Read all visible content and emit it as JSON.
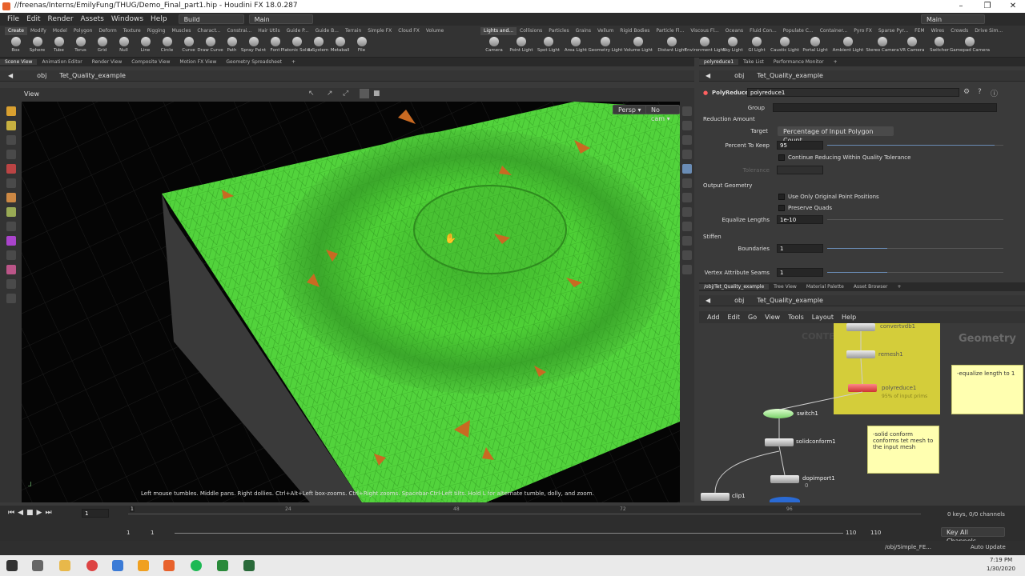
{
  "window": {
    "title": "//freenas/Interns/EmilyFung/THUG/Demo_Final_part1.hip - Houdini FX 18.0.287",
    "minimize": "–",
    "maximize": "❐",
    "close": "✕"
  },
  "menu": {
    "items": [
      "File",
      "Edit",
      "Render",
      "Assets",
      "Windows",
      "Help"
    ],
    "desktop": "Build",
    "main_desk": "Main",
    "right_desk": "Main"
  },
  "shelf": {
    "tabs_left": [
      "Create",
      "Modify",
      "Model",
      "Polygon",
      "Deform",
      "Texture",
      "Rigging",
      "Muscles",
      "Charact...",
      "Constrai...",
      "Hair Utils",
      "Guide P...",
      "Guide B...",
      "Terrain",
      "Simple FX",
      "Cloud FX",
      "Volume"
    ],
    "tools_left": [
      "Box",
      "Sphere",
      "Tube",
      "Torus",
      "Grid",
      "Null",
      "Line",
      "Circle",
      "Curve",
      "Draw Curve",
      "Path",
      "Spray Paint",
      "Font",
      "Platonic Solids",
      "L-System",
      "Metaball",
      "File"
    ],
    "tabs_right": [
      "Lights and...",
      "Collisions",
      "Particles",
      "Grains",
      "Vellum",
      "Rigid Bodies",
      "Particle Fl...",
      "Viscous Fl...",
      "Oceans",
      "Fluid Con...",
      "Populate C...",
      "Container...",
      "Pyro FX",
      "Sparse Pyr...",
      "FEM",
      "Wires",
      "Crowds",
      "Drive Sim..."
    ],
    "tools_right": [
      "Camera",
      "Point Light",
      "Spot Light",
      "Area Light",
      "Geometry Light",
      "Volume Light",
      "Distant Light",
      "Environment Light",
      "Sky Light",
      "GI Light",
      "Caustic Light",
      "Portal Light",
      "Ambient Light",
      "Stereo Camera",
      "VR Camera",
      "Switcher",
      "Gamepad Camera"
    ]
  },
  "left_pane": {
    "tabs": [
      "Scene View",
      "Animation Editor",
      "Render View",
      "Composite View",
      "Motion FX View",
      "Geometry Spreadsheet"
    ],
    "path_root": "obj",
    "path_node": "Tet_Quality_example",
    "view_label": "View",
    "persp": "Persp",
    "cam": "No cam",
    "status_hint": "Left mouse tumbles. Middle pans. Right dollies. Ctrl+Alt+Left box-zooms. Ctrl+Right zooms. Spacebar-Ctrl-Left tilts. Hold L for alternate tumble, dolly, and zoom."
  },
  "right_top": {
    "tabs": [
      "polyreduce1",
      "Take List",
      "Performance Monitor"
    ],
    "path_root": "obj",
    "path_node": "Tet_Quality_example"
  },
  "params": {
    "node_type": "PolyReduce",
    "node_name": "polyreduce1",
    "group_label": "Group",
    "section_reduction": "Reduction Amount",
    "target_label": "Target",
    "target_value": "Percentage of Input Polygon Count",
    "percent_label": "Percent To Keep",
    "percent_value": "95",
    "percent_fraction": 0.95,
    "continue_label": "Continue Reducing Within Quality Tolerance",
    "tolerance_label": "Tolerance",
    "section_output": "Output Geometry",
    "orig_points_label": "Use Only Original Point Positions",
    "preserve_quads_label": "Preserve Quads",
    "equalize_label": "Equalize Lengths",
    "equalize_value": "1e-10",
    "section_stiffen": "Stiffen",
    "boundaries_label": "Boundaries",
    "boundaries_value": "1",
    "vertex_seams_label": "Vertex Attribute Seams",
    "vertex_seams_value": "1"
  },
  "right_bottom": {
    "tabs": [
      "/obj/Tet_Quality_example",
      "Tree View",
      "Material Palette",
      "Asset Browser"
    ],
    "path_root": "obj",
    "path_node": "Tet_Quality_example",
    "menu": [
      "Add",
      "Edit",
      "Go",
      "View",
      "Tools",
      "Layout",
      "Help"
    ],
    "context_label": "Geometry",
    "bg_watermark": "CONTE",
    "nodes": {
      "convertvdb": "convertvdb1",
      "remesh": "remesh1",
      "polyreduce": "polyreduce1",
      "polyreduce_sub": "95% of input prims",
      "switch": "switch1",
      "solidconform": "solidconform1",
      "dopimport": "dopimport1",
      "dopimport_sub": "0",
      "clip": "clip1"
    },
    "sticky_equalize": "-equalize length to 1",
    "sticky_solid": "-solid conform conforms tet mesh to the input mesh"
  },
  "timeline": {
    "frame": "1",
    "ticks": [
      "1",
      "24",
      "48",
      "72",
      "96"
    ],
    "start": "1",
    "start2": "1",
    "end": "110",
    "end2": "110",
    "keys": "0 keys, 0/0 channels",
    "key_all": "Key All Channels",
    "status_path": "/obj/Simple_FE...",
    "auto_update": "Auto Update"
  },
  "taskbar": {
    "time": "7:19 PM",
    "date": "1/30/2020"
  }
}
